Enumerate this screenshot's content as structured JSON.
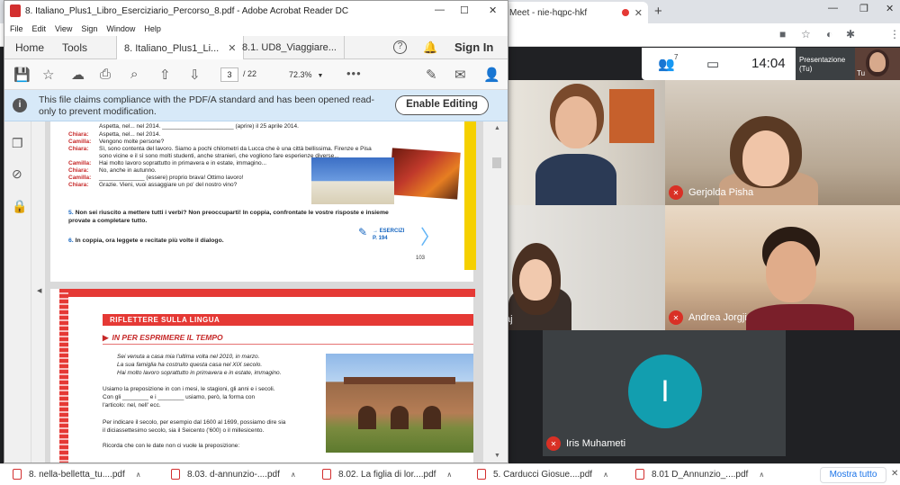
{
  "meet": {
    "tab_title": "Meet - nie-hqpc-hkf",
    "participant_count": "7",
    "clock": "14:04",
    "presentation_label": "Presentazione (Tu)",
    "self_label": "Tu",
    "participants": [
      {
        "name": ""
      },
      {
        "name": "Gerjolda Pisha"
      },
      {
        "name": "aj"
      },
      {
        "name": "Andrea Jorgji"
      },
      {
        "name": "Iris Muhameti",
        "initial": "I"
      },
      {
        "name": ""
      }
    ]
  },
  "acrobat": {
    "title": "8. Italiano_Plus1_Libro_Eserciziario_Percorso_8.pdf - Adobe Acrobat Reader DC",
    "menu": [
      "File",
      "Edit",
      "View",
      "Sign",
      "Window",
      "Help"
    ],
    "home_tab": "Home",
    "tools_tab": "Tools",
    "doc_tabs": [
      "8. Italiano_Plus1_Li...",
      "8.1. UD8_Viaggiare..."
    ],
    "sign_in": "Sign In",
    "page_current": "3",
    "page_total": "/ 22",
    "zoom": "72.3%",
    "notice": "This file claims compliance with the PDF/A standard and has been opened read-only to prevent modification.",
    "enable_editing": "Enable Editing"
  },
  "pdf": {
    "page1_lines": [
      {
        "speaker": "",
        "text": "Aspetta, nel... nel 2014. ______________________ (aprire) il 25 aprile 2014."
      },
      {
        "speaker": "Chiara:",
        "text": "Aspetta, nel... nel 2014."
      },
      {
        "speaker": "Camilla:",
        "text": "Vengono molte persone?"
      },
      {
        "speaker": "Chiara:",
        "text": "Sì, sono contenta del lavoro. Siamo a pochi chilometri da Lucca che è una città bellissima. Firenze e Pisa"
      },
      {
        "speaker": "",
        "text": "sono vicine e il sì sono molti studenti, anche stranieri, che vogliono fare esperienze diverse..."
      },
      {
        "speaker": "Camilla:",
        "text": "Hai molto lavoro soprattutto in primavera e in estate, immagino..."
      },
      {
        "speaker": "Chiara:",
        "text": "No, anche in autunno."
      },
      {
        "speaker": "Camilla:",
        "text": "______________ (essere) proprio brava! Ottimo lavoro!"
      },
      {
        "speaker": "Chiara:",
        "text": "Grazie. Vieni, vuoi assaggiare un po' del nostro vino?"
      }
    ],
    "ex5_num": "5.",
    "ex5": "Non sei riuscito a mettere tutti i verbi? Non preoccuparti! In coppia, confrontate le vostre risposte e insieme",
    "ex5b": "provate a completare tutto.",
    "ex6_num": "6.",
    "ex6": "In coppia, ora leggete e recitate più volte il dialogo.",
    "esercizi": "→ ESERCIZI",
    "esercizi_page": "P. 194",
    "page_number": "103",
    "section_title": "RIFLETTERE SULLA LINGUA",
    "subsection": "IN PER ESPRIMERE IL TEMPO",
    "examples": [
      "Sei venuta a casa mia l'ultima volta nel 2010, in marzo.",
      "La sua famiglia ha costruito questa casa nel XIX secolo.",
      "Hai molto lavoro soprattutto in primavera e in estate, immagino."
    ],
    "rule1": [
      "Usiamo la preposizione in con i mesi, le stagioni, gli anni e i secoli.",
      "Con gli ________ e i ________ usiamo, però, la forma con",
      "l'articolo: nel, nell' ecc."
    ],
    "rule2": [
      "Per indicare il secolo, per esempio dal 1600 al 1699, possiamo dire sia",
      "il diciassettesimo secolo, sia il Seicento ('600) o il millesicento."
    ],
    "rule3": "Ricorda che con le date non ci vuole la preposizione:"
  },
  "downloads": {
    "items": [
      "8. nella-belletta_tu....pdf",
      "8.03. d-annunzio-....pdf",
      "8.02. La figlia di lor....pdf",
      "5. Carducci Giosue....pdf",
      "8.01 D_Annunzio_....pdf"
    ],
    "show_all": "Mostra tutto"
  },
  "colors": {
    "meet_avatar": "#129eaf",
    "mic_off": "#d93025",
    "notice_bg": "#d7e9f8",
    "pdf_red": "#e53935"
  }
}
